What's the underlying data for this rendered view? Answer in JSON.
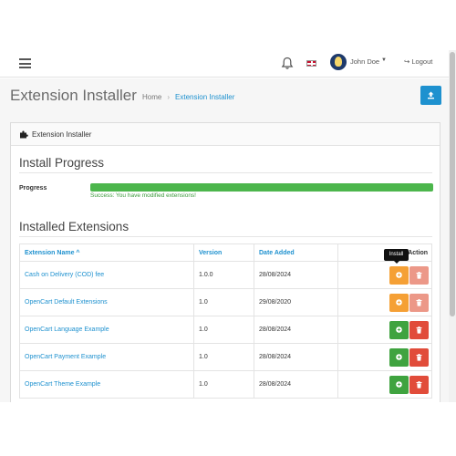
{
  "header": {
    "user_name": "John Doe",
    "logout_label": "Logout",
    "logout_icon": "sign-out-icon",
    "menu_icon": "hamburger-icon",
    "notification_icon": "bell-icon",
    "language_icon": "flag-uk-icon"
  },
  "page": {
    "title": "Extension Installer",
    "breadcrumb": [
      "Home",
      "Extension Installer"
    ]
  },
  "panel": {
    "title": "Extension Installer",
    "icon": "puzzle-icon"
  },
  "progress": {
    "section_title": "Install Progress",
    "label": "Progress",
    "percent": 100,
    "message": "Success: You have modified extensions!"
  },
  "installed": {
    "section_title": "Installed Extensions",
    "columns": {
      "name": "Extension Name",
      "version": "Version",
      "date": "Date Added",
      "action": "Action"
    },
    "sort_indicator": "^",
    "rows": [
      {
        "name": "Cash on Delivery (COD) fee",
        "version": "1.0.0",
        "date": "28/08/2024",
        "install_state": "uninstalled"
      },
      {
        "name": "OpenCart Default Extensions",
        "version": "1.0",
        "date": "29/08/2020",
        "install_state": "uninstalled"
      },
      {
        "name": "OpenCart Language Example",
        "version": "1.0",
        "date": "28/08/2024",
        "install_state": "installed"
      },
      {
        "name": "OpenCart Payment Example",
        "version": "1.0",
        "date": "28/08/2024",
        "install_state": "installed"
      },
      {
        "name": "OpenCart Theme Example",
        "version": "1.0",
        "date": "28/08/2024",
        "install_state": "installed"
      }
    ],
    "tooltip": "Install"
  },
  "colors": {
    "primary": "#1e91cf",
    "success": "#4cb64c",
    "warning": "#f5a035",
    "danger": "#e14c3a"
  }
}
